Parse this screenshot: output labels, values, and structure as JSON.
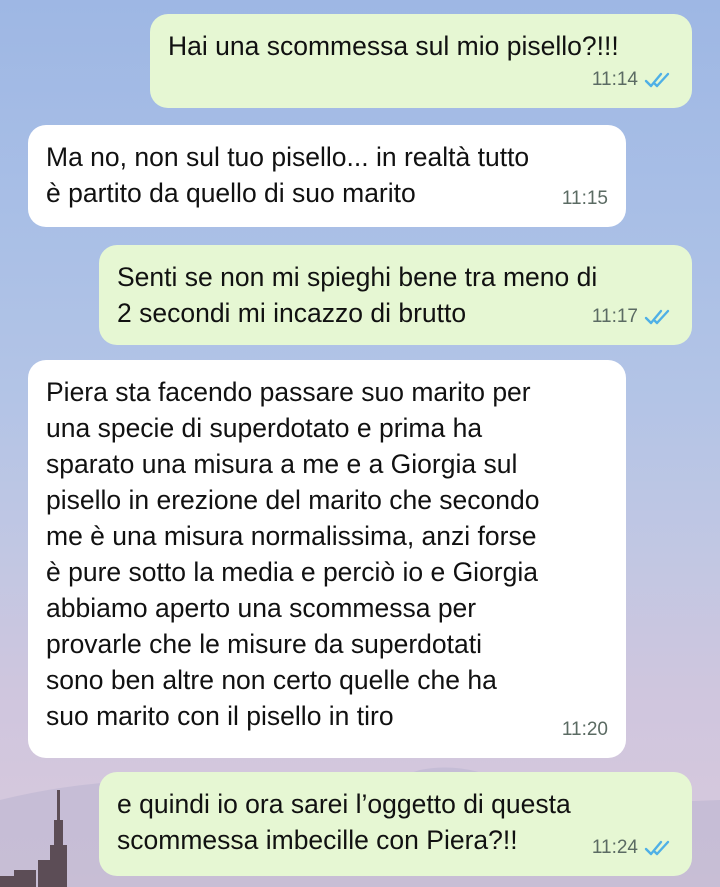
{
  "chat": {
    "messages": [
      {
        "direction": "outgoing",
        "text": "Hai una scommessa sul mio pisello?!!!",
        "time": "11:14",
        "status": "read"
      },
      {
        "direction": "incoming",
        "text": "Ma no, non sul tuo pisello... in realtà tutto\nè partito da quello di suo marito",
        "time": "11:15"
      },
      {
        "direction": "outgoing",
        "text": "Senti se non mi spieghi bene tra meno di\n2 secondi mi incazzo di brutto",
        "time": "11:17",
        "status": "read"
      },
      {
        "direction": "incoming",
        "text": "Piera sta facendo passare suo marito per\nuna specie di superdotato e prima ha\nsparato una misura a me e a Giorgia sul\npisello in erezione del marito che secondo\nme è una misura normalissima, anzi forse\nè pure sotto la media e perciò io e Giorgia\nabbiamo aperto una scommessa per\nprovarle che le misure da superdotati\nsono ben altre non certo quelle che ha\nsuo marito con il pisello in tiro",
        "time": "11:20"
      },
      {
        "direction": "outgoing",
        "text": "e quindi io ora sarei l’oggetto di questa\nscommessa imbecille con Piera?!!",
        "time": "11:24",
        "status": "read"
      }
    ]
  },
  "colors": {
    "outgoing_bubble": "#e6f7d3",
    "incoming_bubble": "#ffffff",
    "read_ticks": "#4fb0e6",
    "time_text": "#5b6b63"
  },
  "icons": {
    "read_status": "double-check-icon"
  }
}
